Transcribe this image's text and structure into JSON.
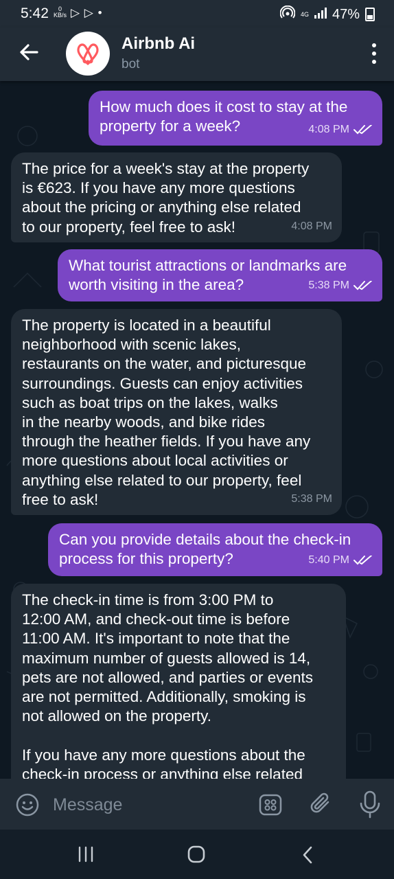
{
  "status_bar": {
    "time": "5:42",
    "data_speed": "0",
    "data_unit": "KB/s",
    "notif_icons": "▷ ▷ •",
    "network": "4G",
    "battery": "47%"
  },
  "header": {
    "title": "Airbnb Ai",
    "subtitle": "bot"
  },
  "messages": [
    {
      "direction": "out",
      "text": "How much does it cost to stay at the\nproperty for a week?",
      "time": "4:08 PM",
      "read": true
    },
    {
      "direction": "in",
      "text": "The price for a week's stay at the property\nis €623. If you have any more questions\nabout the pricing or anything else related\nto our property, feel free to ask!",
      "time": "4:08 PM"
    },
    {
      "direction": "out",
      "text": "What tourist attractions or landmarks are\nworth visiting in the area?",
      "time": "5:38 PM",
      "read": true
    },
    {
      "direction": "in",
      "text": "The property is located in a beautiful\nneighborhood with scenic lakes,\nrestaurants on the water, and picturesque\nsurroundings. Guests can enjoy activities\nsuch as boat trips on the lakes, walks\nin the nearby woods, and bike rides\nthrough the heather fields. If you have any\nmore questions about local activities or\nanything else related to our property, feel\nfree to ask!",
      "time": "5:38 PM"
    },
    {
      "direction": "out",
      "text": "Can you provide details about the check-in\nprocess for this property?",
      "time": "5:40 PM",
      "read": true
    },
    {
      "direction": "in",
      "text": "The check-in time is from 3:00 PM to\n12:00 AM, and check-out time is before\n11:00 AM. It's important to note that the\nmaximum number of guests allowed is 14,\npets are not allowed, and parties or events\nare not permitted. Additionally, smoking is\nnot allowed on the property.\n\nIf you have any more questions about the\ncheck-in process or anything else related",
      "time": ""
    }
  ],
  "composer": {
    "placeholder": "Message"
  },
  "colors": {
    "outgoing_bubble": "#7a46c5",
    "incoming_bubble": "#222c36",
    "chat_background": "#0e1822",
    "airbnb_logo": "#ff5a5f"
  }
}
